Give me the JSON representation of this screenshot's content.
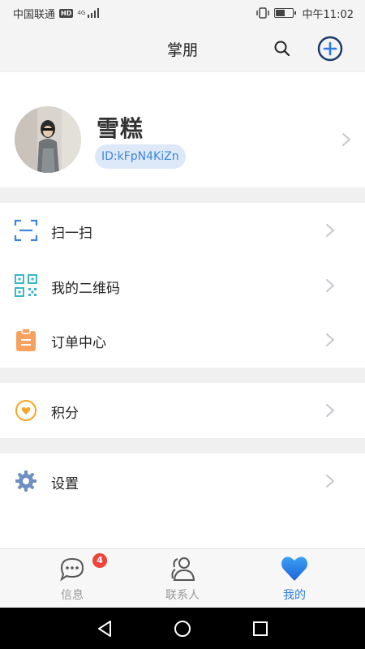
{
  "status_bar": {
    "carrier": "中国联通",
    "hd_badge": "HD",
    "network": "4G",
    "time": "中午11:02",
    "battery_level": 0.6
  },
  "header": {
    "title": "掌朋",
    "search_icon": "search-icon",
    "add_icon": "plus-circle-icon"
  },
  "profile": {
    "name": "雪糕",
    "id_label": "ID:kFpN4KiZn"
  },
  "menu_main": [
    {
      "label": "扫一扫",
      "icon": "scan-icon",
      "color": "#3e86dc"
    },
    {
      "label": "我的二维码",
      "icon": "qr-code-icon",
      "color": "#39b7c7"
    },
    {
      "label": "订单中心",
      "icon": "clipboard-icon",
      "color": "#f6a15e"
    }
  ],
  "menu_points": {
    "label": "积分",
    "icon": "points-heart-icon",
    "color": "#f5a623"
  },
  "menu_settings": {
    "label": "设置",
    "icon": "gear-icon",
    "color": "#6e8fbf"
  },
  "tab_bar": {
    "tabs": [
      {
        "label": "信息",
        "icon": "chat-icon",
        "badge": "4",
        "active": false
      },
      {
        "label": "联系人",
        "icon": "contacts-icon",
        "active": false
      },
      {
        "label": "我的",
        "icon": "heart-icon",
        "active": true
      }
    ]
  },
  "colors": {
    "accent": "#2d7be5",
    "badge": "#f0433a",
    "id_bg": "#dde9f8"
  }
}
